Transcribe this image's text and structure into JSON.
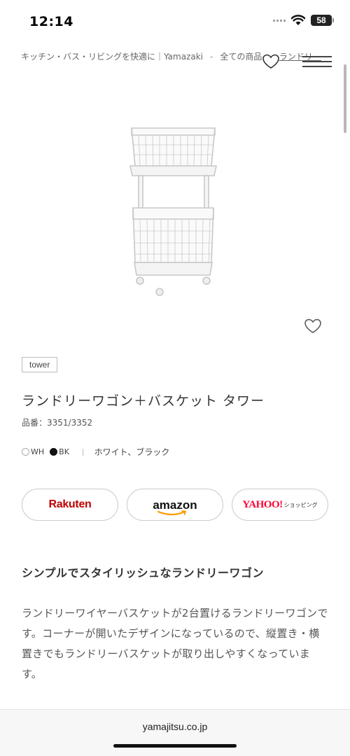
{
  "status": {
    "time": "12:14",
    "battery": "58"
  },
  "breadcrumb": {
    "items": [
      "キッチン・バス・リビングを快適に｜Yamazaki",
      "全ての商品",
      "ランドリー"
    ],
    "separator": "-"
  },
  "product": {
    "tag": "tower",
    "title": "ランドリーワゴン＋バスケット タワー",
    "code": "品番：3351/3352",
    "colors": [
      {
        "code": "WH",
        "hex": "#ffffff"
      },
      {
        "code": "BK",
        "hex": "#111111"
      }
    ],
    "color_names": "ホワイト、ブラック"
  },
  "stores": {
    "rakuten": "Rakuten",
    "amazon": "amazon",
    "yahoo": "YAHOO!",
    "yahoo_sub": "ショッピング"
  },
  "section": {
    "title": "シンプルでスタイリッシュなランドリーワゴン",
    "description": "ランドリーワイヤーバスケットが2台置けるランドリーワゴンです。コーナーが開いたデザインになっているので、縦置き・横置きでもランドリーバスケットが取り出しやすくなっています。"
  },
  "browser": {
    "url": "yamajitsu.co.jp"
  },
  "icons": {
    "header": [
      "heart-icon",
      "menu-icon"
    ],
    "image": [
      "heart-icon"
    ]
  }
}
